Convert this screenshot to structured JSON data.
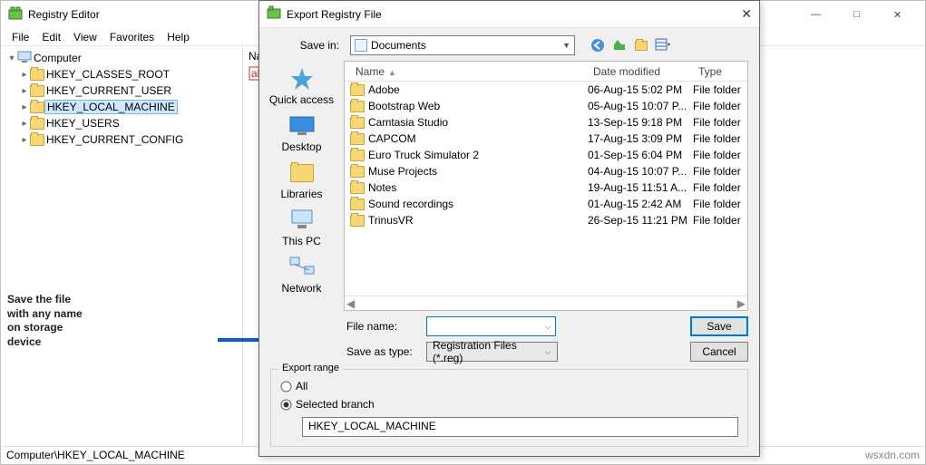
{
  "reg": {
    "title": "Registry Editor",
    "menu": [
      "File",
      "Edit",
      "View",
      "Favorites",
      "Help"
    ],
    "win_min": "—",
    "win_max": "□",
    "win_close": "✕",
    "tree": {
      "root": "Computer",
      "items": [
        "HKEY_CLASSES_ROOT",
        "HKEY_CURRENT_USER",
        "HKEY_LOCAL_MACHINE",
        "HKEY_USERS",
        "HKEY_CURRENT_CONFIG"
      ],
      "selected_index": 2
    },
    "list_hdr_name": "Na",
    "status_left": "Computer\\HKEY_LOCAL_MACHINE",
    "status_right": "wsxdn.com"
  },
  "dlg": {
    "title": "Export Registry File",
    "savein_lbl": "Save in:",
    "savein_val": "Documents",
    "places": [
      "Quick access",
      "Desktop",
      "Libraries",
      "This PC",
      "Network"
    ],
    "cols": {
      "name": "Name",
      "date": "Date modified",
      "type": "Type"
    },
    "rows": [
      {
        "name": "Adobe",
        "date": "06-Aug-15 5:02 PM",
        "type": "File folder"
      },
      {
        "name": "Bootstrap Web",
        "date": "05-Aug-15 10:07 P...",
        "type": "File folder"
      },
      {
        "name": "Camtasia Studio",
        "date": "13-Sep-15 9:18 PM",
        "type": "File folder"
      },
      {
        "name": "CAPCOM",
        "date": "17-Aug-15 3:09 PM",
        "type": "File folder"
      },
      {
        "name": "Euro Truck Simulator 2",
        "date": "01-Sep-15 6:04 PM",
        "type": "File folder"
      },
      {
        "name": "Muse Projects",
        "date": "04-Aug-15 10:07 P...",
        "type": "File folder"
      },
      {
        "name": "Notes",
        "date": "19-Aug-15 11:51 A...",
        "type": "File folder"
      },
      {
        "name": "Sound recordings",
        "date": "01-Aug-15 2:42 AM",
        "type": "File folder"
      },
      {
        "name": "TrinusVR",
        "date": "26-Sep-15 11:21 PM",
        "type": "File folder"
      }
    ],
    "file_name_lbl": "File name:",
    "file_name_val": "",
    "saveas_lbl": "Save as type:",
    "saveas_val": "Registration Files (*.reg)",
    "save_btn": "Save",
    "cancel_btn": "Cancel",
    "export_range": "Export range",
    "radio_all": "All",
    "radio_branch": "Selected branch",
    "branch_val": "HKEY_LOCAL_MACHINE"
  },
  "annot": {
    "line1": "Save the file",
    "line2": "with any name",
    "line3": "on storage",
    "line4": "device"
  }
}
